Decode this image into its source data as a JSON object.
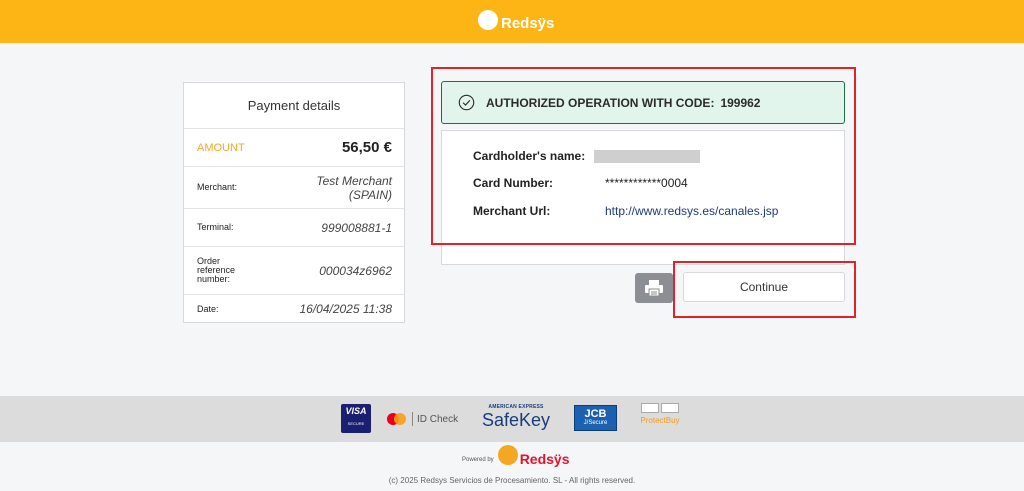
{
  "header": {
    "brand": "Redsÿs"
  },
  "payment_details": {
    "title": "Payment details",
    "amount_label": "AMOUNT",
    "amount_value": "56,50  €",
    "merchant_label": "Merchant:",
    "merchant_value": "Test Merchant (SPAIN)",
    "terminal_label": "Terminal:",
    "terminal_value": "999008881-1",
    "order_label": "Order reference number:",
    "order_value": "000034z6962",
    "date_label": "Date:",
    "date_value": "16/04/2025   11:38"
  },
  "result": {
    "status_text": "AUTHORIZED OPERATION WITH CODE:",
    "code": "199962",
    "cardholder_label": "Cardholder's name:",
    "card_number_label": "Card Number:",
    "card_number_value": "************0004",
    "merchant_url_label": "Merchant Url:",
    "merchant_url_value": "http://www.redsys.es/canales.jsp"
  },
  "actions": {
    "print_icon": "printer-icon",
    "continue_label": "Continue"
  },
  "footer": {
    "visa_top": "VISA",
    "visa_bottom": "SECURE",
    "mc_text": "ID Check",
    "amex_top": "AMERICAN EXPRESS",
    "amex_bottom": "SafeKey",
    "jcb_top": "JCB",
    "jcb_bottom": "J/Secure",
    "protectbuy": "ProtectBuy",
    "powered_label": "Powered by",
    "powered_brand": "Redsÿs",
    "copyright": "(c) 2025 Redsys Servicios de Procesamiento. SL - All rights reserved."
  },
  "colors": {
    "header": "#fdb515",
    "accent": "#f5a623",
    "success_bg": "#e2f5ec",
    "success_border": "#1e6e4c",
    "highlight": "#e0232a"
  }
}
